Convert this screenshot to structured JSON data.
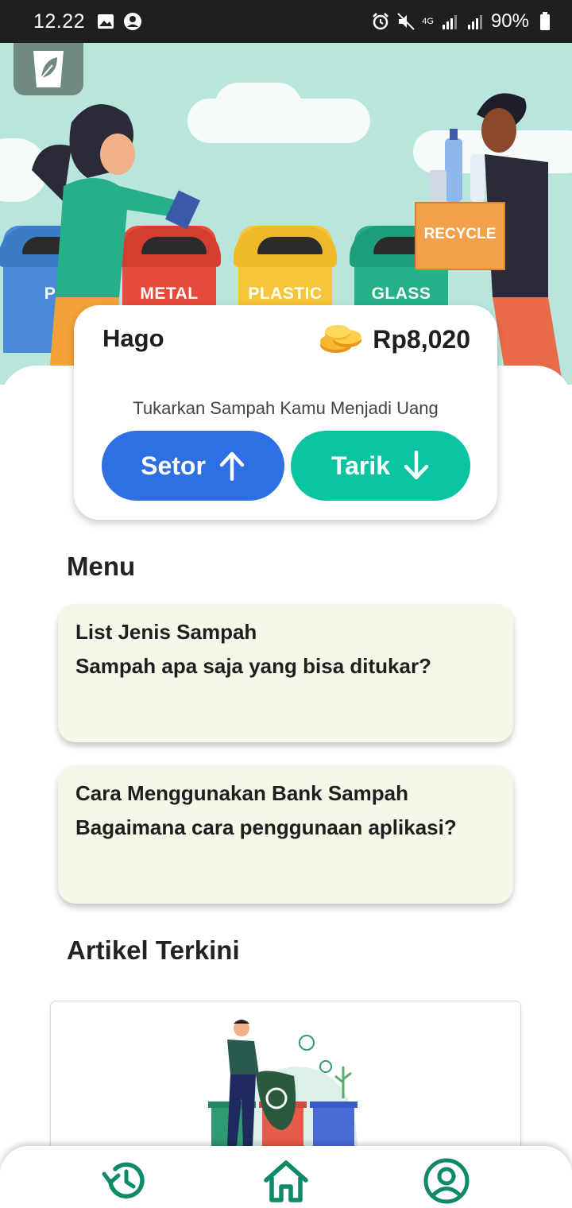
{
  "status_bar": {
    "time": "12.22",
    "network": "4G",
    "battery": "90%"
  },
  "hero": {
    "bins": [
      "P",
      "METAL",
      "PLASTIC",
      "GLASS"
    ],
    "box_label": "RECYCLE"
  },
  "balance_card": {
    "user_name": "Hago",
    "balance": "Rp8,020",
    "tagline": "Tukarkan Sampah Kamu Menjadi Uang",
    "setor_label": "Setor",
    "tarik_label": "Tarik"
  },
  "menu": {
    "title": "Menu",
    "items": [
      {
        "title": "List Jenis Sampah",
        "subtitle": "Sampah apa saja yang bisa ditukar?"
      },
      {
        "title": "Cara Menggunakan Bank Sampah",
        "subtitle": "Bagaimana cara penggunaan aplikasi?"
      }
    ]
  },
  "articles": {
    "title": "Artikel Terkini"
  },
  "bottom_nav": {
    "items": [
      "history-icon",
      "home-icon",
      "profile-icon"
    ],
    "accent": "#0e8a6a"
  },
  "colors": {
    "setor": "#2f6fe4",
    "tarik": "#09c4a0",
    "menu_card_bg": "#f4f8e8"
  }
}
